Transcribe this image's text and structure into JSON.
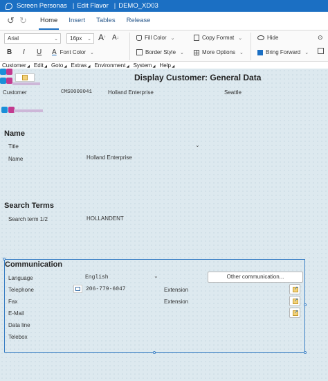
{
  "titlebar": {
    "app": "Screen Personas",
    "mode": "Edit Flavor",
    "flavor": "DEMO_XD03",
    "separator": "|"
  },
  "tabs": [
    {
      "label": "Home",
      "active": true
    },
    {
      "label": "Insert",
      "active": false
    },
    {
      "label": "Tables",
      "active": false
    },
    {
      "label": "Release",
      "active": false
    }
  ],
  "ribbon": {
    "font_family": "Arial",
    "font_size": "16px",
    "grow_font": "A",
    "shrink_font": "A",
    "bold": "B",
    "italic": "I",
    "underline": "U",
    "font_color_glyph": "A",
    "font_color": "Font Color",
    "fill_color": "Fill Color",
    "border_style": "Border Style",
    "copy_format": "Copy Format",
    "more_options": "More Options",
    "hide": "Hide",
    "bring_forward": "Bring Forward"
  },
  "menubar": [
    "Customer",
    "Edit",
    "Goto",
    "Extras",
    "Environment",
    "System",
    "Help"
  ],
  "screen": {
    "title": "Display Customer: General Data",
    "customer_label": "Customer",
    "customer_number": "CMS0000041",
    "customer_name": "Holland Enterprise",
    "customer_city": "Seattle"
  },
  "name_section": {
    "heading": "Name",
    "title_label": "Title",
    "name_label": "Name",
    "name_value": "Holland Enterprise"
  },
  "search_section": {
    "heading": "Search Terms",
    "term_label": "Search term 1/2",
    "term_value": "HOLLANDENT"
  },
  "communication": {
    "heading": "Communication",
    "language_label": "Language",
    "language_value": "English",
    "other_button": "Other communication...",
    "telephone_label": "Telephone",
    "telephone_value": "206-779-6047",
    "extension_label": "Extension",
    "fax_label": "Fax",
    "fax_extension_label": "Extension",
    "email_label": "E-Mail",
    "dataline_label": "Data line",
    "telebox_label": "Telebox"
  },
  "colors": {
    "titlebar": "#1b6fc3",
    "canvas": "#dde9ef",
    "group_border": "#3a7fc4"
  }
}
